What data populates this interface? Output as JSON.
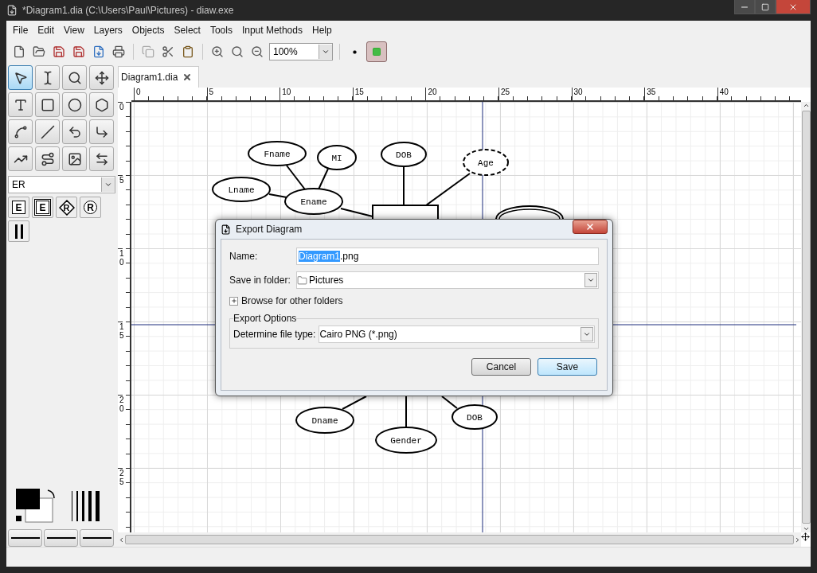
{
  "window": {
    "title": "*Diagram1.dia (C:\\Users\\Paul\\Pictures) - diaw.exe"
  },
  "menu": [
    "File",
    "Edit",
    "View",
    "Layers",
    "Objects",
    "Select",
    "Tools",
    "Input Methods",
    "Help"
  ],
  "toolbar": {
    "zoom": "100%"
  },
  "toolbox": [
    {
      "selected": true
    },
    {
      "selected": false
    },
    {
      "selected": false
    },
    {
      "selected": false
    },
    {
      "selected": false
    },
    {
      "selected": false
    },
    {
      "selected": false
    },
    {
      "selected": false
    },
    {
      "selected": false
    },
    {
      "selected": false
    },
    {
      "selected": false
    },
    {
      "selected": false
    },
    {
      "selected": false
    },
    {
      "selected": false
    },
    {
      "selected": false
    },
    {
      "selected": false
    }
  ],
  "sheet": {
    "value": "ER"
  },
  "sheet_shapes": [
    {
      "kind": "entity",
      "label": "E"
    },
    {
      "kind": "weak-entity",
      "label": "E"
    },
    {
      "kind": "relationship",
      "label": "R"
    },
    {
      "kind": "attribute",
      "label": "R"
    },
    {
      "kind": "participation"
    }
  ],
  "tab": {
    "label": "Diagram1.dia"
  },
  "rulers": {
    "horizontal": [
      "0",
      "5",
      "10",
      "15",
      "20",
      "25",
      "30",
      "35",
      "40"
    ],
    "vertical": [
      "0",
      "5",
      "10",
      "15",
      "20",
      "25"
    ]
  },
  "diagram": {
    "nodes": [
      {
        "kind": "attribute",
        "label": "Fname"
      },
      {
        "kind": "attribute",
        "label": "MI"
      },
      {
        "kind": "attribute",
        "label": "DOB"
      },
      {
        "kind": "derived",
        "label": "Age"
      },
      {
        "kind": "attribute",
        "label": "Lname"
      },
      {
        "kind": "attribute",
        "label": "Ename"
      },
      {
        "kind": "entity"
      },
      {
        "kind": "multivalued"
      },
      {
        "kind": "attribute",
        "label": "Dname"
      },
      {
        "kind": "attribute",
        "label": "Gender"
      },
      {
        "kind": "attribute",
        "label": "DOB"
      }
    ]
  },
  "dialog": {
    "title": "Export Diagram",
    "name_label": "Name:",
    "name_selected": "Diagram1",
    "name_rest": ".png",
    "folder_label": "Save in folder:",
    "folder": "Pictures",
    "browse": {
      "label": "Browse for other folders",
      "expanded": false
    },
    "options_title": "Export Options",
    "file_type_label": "Determine file type:",
    "file_type": "Cairo PNG (*.png)",
    "buttons": [
      {
        "label": "Cancel",
        "default": false
      },
      {
        "label": "Save",
        "default": true
      }
    ]
  }
}
